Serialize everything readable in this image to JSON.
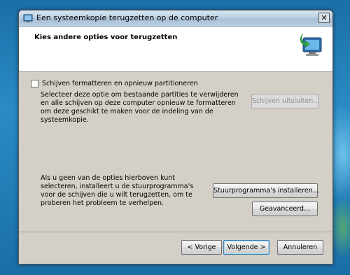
{
  "window": {
    "title": "Een systeemkopie terugzetten op de computer",
    "close_glyph": "✕"
  },
  "header": {
    "title": "Kies andere opties voor terugzetten",
    "icon": "computer-restore-icon"
  },
  "format_option": {
    "checkbox_label": "Schijven formatteren en opnieuw partitioneren",
    "checked": false,
    "description": "Selecteer deze optie om bestaande partities te verwijderen en alle schijven op deze computer opnieuw te formatteren om deze geschikt te maken voor de indeling van de systeemkopie.",
    "exclude_button": "Schijven uitsluiten..."
  },
  "driver_option": {
    "description": "Als u geen van de opties hierboven kunt selecteren, installeert u de stuurprogramma's voor de schijven die u wilt terugzetten, om te proberen het probleem te verhelpen.",
    "install_button": "Stuurprogramma's installeren...",
    "advanced_button": "Geavanceerd..."
  },
  "nav": {
    "back": "< Vorige",
    "next": "Volgende >",
    "cancel": "Annuleren"
  },
  "colors": {
    "desktop": "#1b6fa8",
    "dialog": "#d4d0c8",
    "header": "#ffffff"
  }
}
